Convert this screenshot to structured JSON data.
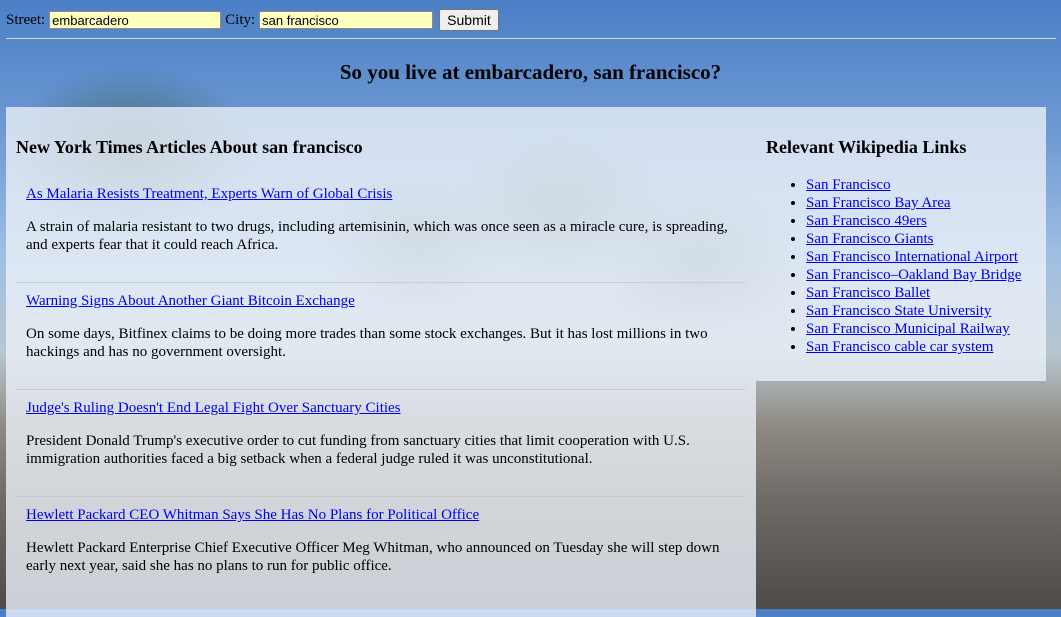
{
  "form": {
    "street_label": "Street:",
    "street_value": "embarcadero",
    "city_label": "City:",
    "city_value": "san francisco",
    "submit_label": "Submit"
  },
  "heading": "So you live at embarcadero, san francisco?",
  "articles": {
    "title": "New York Times Articles About san francisco",
    "items": [
      {
        "headline": "As Malaria Resists Treatment, Experts Warn of Global Crisis",
        "summary": "A strain of malaria resistant to two drugs, including artemisinin, which was once seen as a miracle cure, is spreading, and experts fear that it could reach Africa."
      },
      {
        "headline": "Warning Signs About Another Giant Bitcoin Exchange",
        "summary": "On some days, Bitfinex claims to be doing more trades than some stock exchanges. But it has lost millions in two hackings and has no government oversight."
      },
      {
        "headline": "Judge's Ruling Doesn't End Legal Fight Over Sanctuary Cities",
        "summary": "President Donald Trump's executive order to cut funding from sanctuary cities that limit cooperation with U.S. immigration authorities faced a big setback when a federal judge ruled it was unconstitutional."
      },
      {
        "headline": "Hewlett Packard CEO Whitman Says She Has No Plans for Political Office",
        "summary": "Hewlett Packard Enterprise Chief Executive Officer Meg Whitman, who announced on Tuesday she will step down early next year, said she has no plans to run for public office."
      }
    ]
  },
  "wikipedia": {
    "title": "Relevant Wikipedia Links",
    "links": [
      "San Francisco",
      "San Francisco Bay Area",
      "San Francisco 49ers",
      "San Francisco Giants",
      "San Francisco International Airport",
      "San Francisco–Oakland Bay Bridge",
      "San Francisco Ballet",
      "San Francisco State University",
      "San Francisco Municipal Railway",
      "San Francisco cable car system"
    ]
  }
}
